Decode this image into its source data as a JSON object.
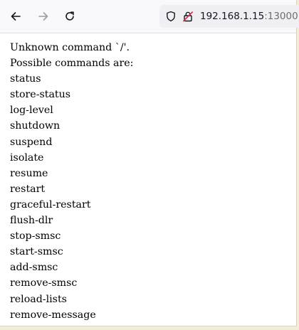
{
  "browser": {
    "url_host": "192.168.1.15",
    "url_port": ":13000",
    "icons": [
      "back-arrow-icon",
      "forward-arrow-icon",
      "reload-icon",
      "shield-icon",
      "insecure-lock-icon"
    ]
  },
  "page": {
    "error_line": "Unknown command `/'.",
    "intro_line": "Possible commands are:",
    "commands": [
      "status",
      "store-status",
      "log-level",
      "shutdown",
      "suspend",
      "isolate",
      "resume",
      "restart",
      "graceful-restart",
      "flush-dlr",
      "stop-smsc",
      "start-smsc",
      "add-smsc",
      "remove-smsc",
      "reload-lists",
      "remove-message"
    ]
  }
}
